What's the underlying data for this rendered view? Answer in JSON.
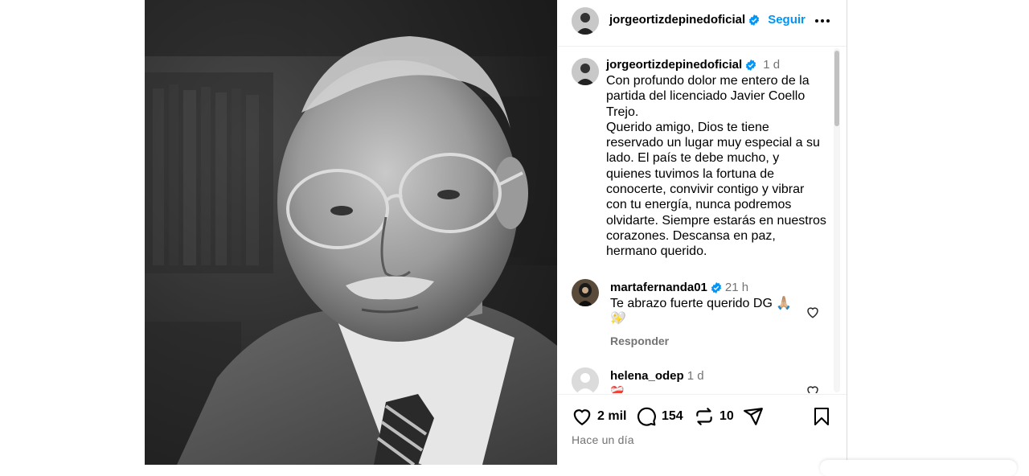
{
  "post": {
    "author": "jorgeortizdepinedoficial",
    "follow_label": "Seguir",
    "more_icon": "more-horizontal-icon",
    "photo_alt": "black-and-white portrait photo"
  },
  "caption": {
    "username": "jorgeortizdepinedoficial",
    "age": "1 d",
    "text": "Con profundo dolor me entero de la partida del licenciado Javier Coello Trejo.\nQuerido amigo, Dios te tiene reservado un lugar muy especial a su lado. El país te debe mucho, y quienes tuvimos la fortuna de conocerte, convivir contigo y vibrar con tu energía, nunca podremos olvidarte. Siempre estarás en nuestros corazones. Descansa en paz, hermano querido."
  },
  "comments": [
    {
      "username": "martafernanda01",
      "age": "21 h",
      "text": "Te abrazo fuerte querido DG 🙏🏼🤍",
      "text_line2": "✨",
      "reply_label": "Responder",
      "verified": true
    },
    {
      "username": "helena_odep",
      "age": "1 d",
      "text": "❤️‍🩹",
      "verified": false
    }
  ],
  "actions": {
    "likes": "2 mil",
    "comments": "154",
    "reposts": "10",
    "time_ago": "Hace un día"
  },
  "colors": {
    "accent": "#0095f6",
    "verified": "#0095f6",
    "muted": "#737373"
  }
}
